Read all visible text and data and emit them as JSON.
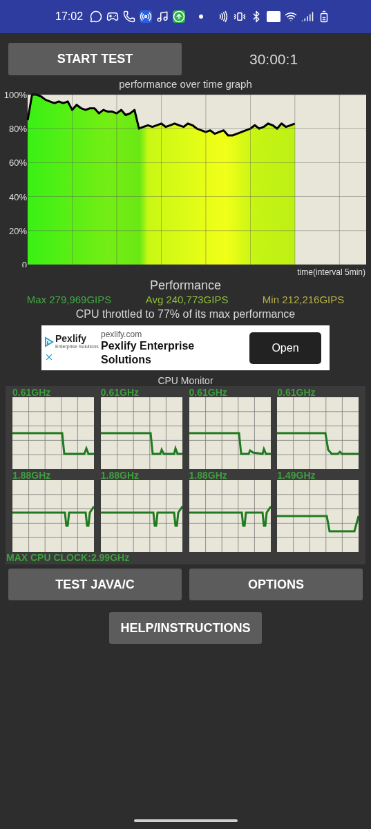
{
  "status_bar": {
    "time": "17:02"
  },
  "header": {
    "start_button": "START TEST",
    "timer": "30:00:1"
  },
  "performance_graph": {
    "chart_data": {
      "type": "area",
      "grid": true,
      "title": "performance over time graph",
      "xlabel": "time(interval 5min)",
      "ylim": [
        0,
        100
      ],
      "yticks": [
        {
          "value": 0,
          "label": "0"
        },
        {
          "value": 20,
          "label": "20%"
        },
        {
          "value": 40,
          "label": "40%"
        },
        {
          "value": 60,
          "label": "60%"
        },
        {
          "value": 80,
          "label": "80%"
        },
        {
          "value": 100,
          "label": "100%"
        }
      ],
      "categories": [
        null,
        null,
        null,
        null,
        null,
        null,
        null,
        null,
        null,
        null,
        null,
        null,
        null,
        null,
        null,
        null,
        null,
        null,
        null,
        null,
        null,
        null,
        null,
        null,
        null,
        null,
        null,
        null,
        null,
        null,
        null,
        null,
        null,
        null,
        null,
        null,
        null,
        null,
        null,
        null,
        null,
        null,
        null,
        null,
        null,
        null,
        null,
        null,
        null,
        null,
        null,
        null,
        null,
        null,
        null,
        null,
        null,
        null,
        null,
        null,
        null,
        null,
        null,
        null,
        null,
        null,
        null,
        null,
        null,
        null,
        null,
        null,
        null,
        null,
        null,
        null,
        null
      ],
      "series": [
        {
          "color": "#000000",
          "values": [
            85,
            100,
            100,
            99,
            97,
            96,
            95,
            96,
            95,
            96,
            91,
            94,
            92,
            91,
            92,
            92,
            89,
            91,
            90,
            90,
            89,
            91,
            88,
            89,
            91,
            80,
            81,
            82,
            81,
            82,
            83,
            81,
            82,
            83,
            82,
            81,
            83,
            82,
            80,
            79,
            78,
            79,
            77,
            78,
            79,
            76,
            76,
            77,
            78,
            79,
            80,
            82,
            80,
            81,
            83,
            82,
            80,
            83,
            81,
            82,
            83,
            null,
            null,
            null,
            null,
            null,
            null,
            null,
            null,
            null,
            null,
            null,
            null,
            null,
            null,
            null,
            null
          ]
        }
      ]
    }
  },
  "performance": {
    "title": "Performance",
    "max": "Max 279,969GIPS",
    "avg": "Avg 240,773GIPS",
    "min": "Min 212,216GIPS",
    "throttle_note": "CPU throttled to 77% of its max performance"
  },
  "ad": {
    "logo_name": "Pexlify",
    "logo_tagline": "Enterprise Solutions",
    "domain": "pexlify.com",
    "headline": "Pexlify Enterprise Solutions",
    "open_button": "Open"
  },
  "cpu_monitor": {
    "title": "CPU Monitor",
    "cores": [
      {
        "frequency": "0.61GHz"
      },
      {
        "frequency": "0.61GHz"
      },
      {
        "frequency": "0.61GHz"
      },
      {
        "frequency": "0.61GHz"
      },
      {
        "frequency": "1.88GHz"
      },
      {
        "frequency": "1.88GHz"
      },
      {
        "frequency": "1.88GHz"
      },
      {
        "frequency": "1.49GHz"
      }
    ],
    "max_clock": "MAX CPU CLOCK:2.99GHz"
  },
  "buttons": [
    "TEST JAVA/C",
    "OPTIONS",
    "HELP/INSTRUCTIONS"
  ]
}
